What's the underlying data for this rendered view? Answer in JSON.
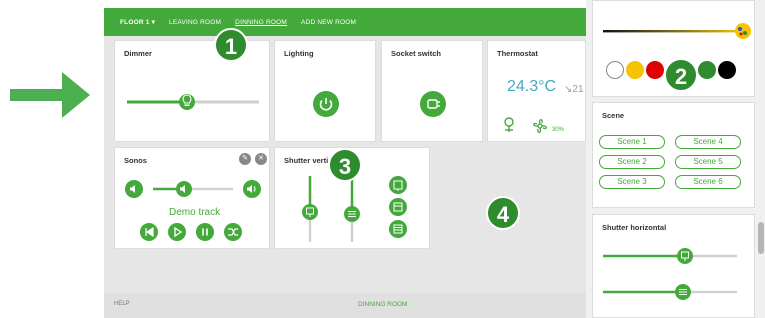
{
  "topbar": {
    "floor": "FLOOR 1 ▾",
    "tabs": [
      "LEAVING ROOM",
      "DINNING ROOM",
      "ADD NEW ROOM"
    ]
  },
  "cards": {
    "dimmer": "Dimmer",
    "lighting": "Lighting",
    "socket": "Socket switch",
    "thermostat": "Thermostat",
    "thermo_temp": "24.3°C",
    "thermo_target": "↘21",
    "thermo_fan": "30%",
    "sonos": "Sonos",
    "sonos_track": "Demo track",
    "shutter_vertical": "Shutter verti"
  },
  "footer": {
    "help": "HELP",
    "room": "DINNING ROOM"
  },
  "right": {
    "scene_title": "Scene",
    "scenes": [
      "Scene 1",
      "Scene 4",
      "Scene 2",
      "Scene 5",
      "Scene 3",
      "Scene 6"
    ],
    "shutter_horizontal": "Shutter horizontal"
  },
  "badges": [
    "1",
    "2",
    "3",
    "4"
  ],
  "colors": {
    "accent": "#43a93a",
    "badge": "#2e8b2e",
    "arrow": "#4caf50",
    "swatches": [
      "#ffffff",
      "#f5c400",
      "#e00000",
      "#2e8b2e",
      "#000000"
    ]
  },
  "levels": {
    "dimmer": 0.5,
    "sonos_volume": 0.45,
    "color_slider": 1.0,
    "shutter_h1": 0.65,
    "shutter_h2": 0.6,
    "shutter_v1": 0.45,
    "shutter_v2": 0.5
  }
}
